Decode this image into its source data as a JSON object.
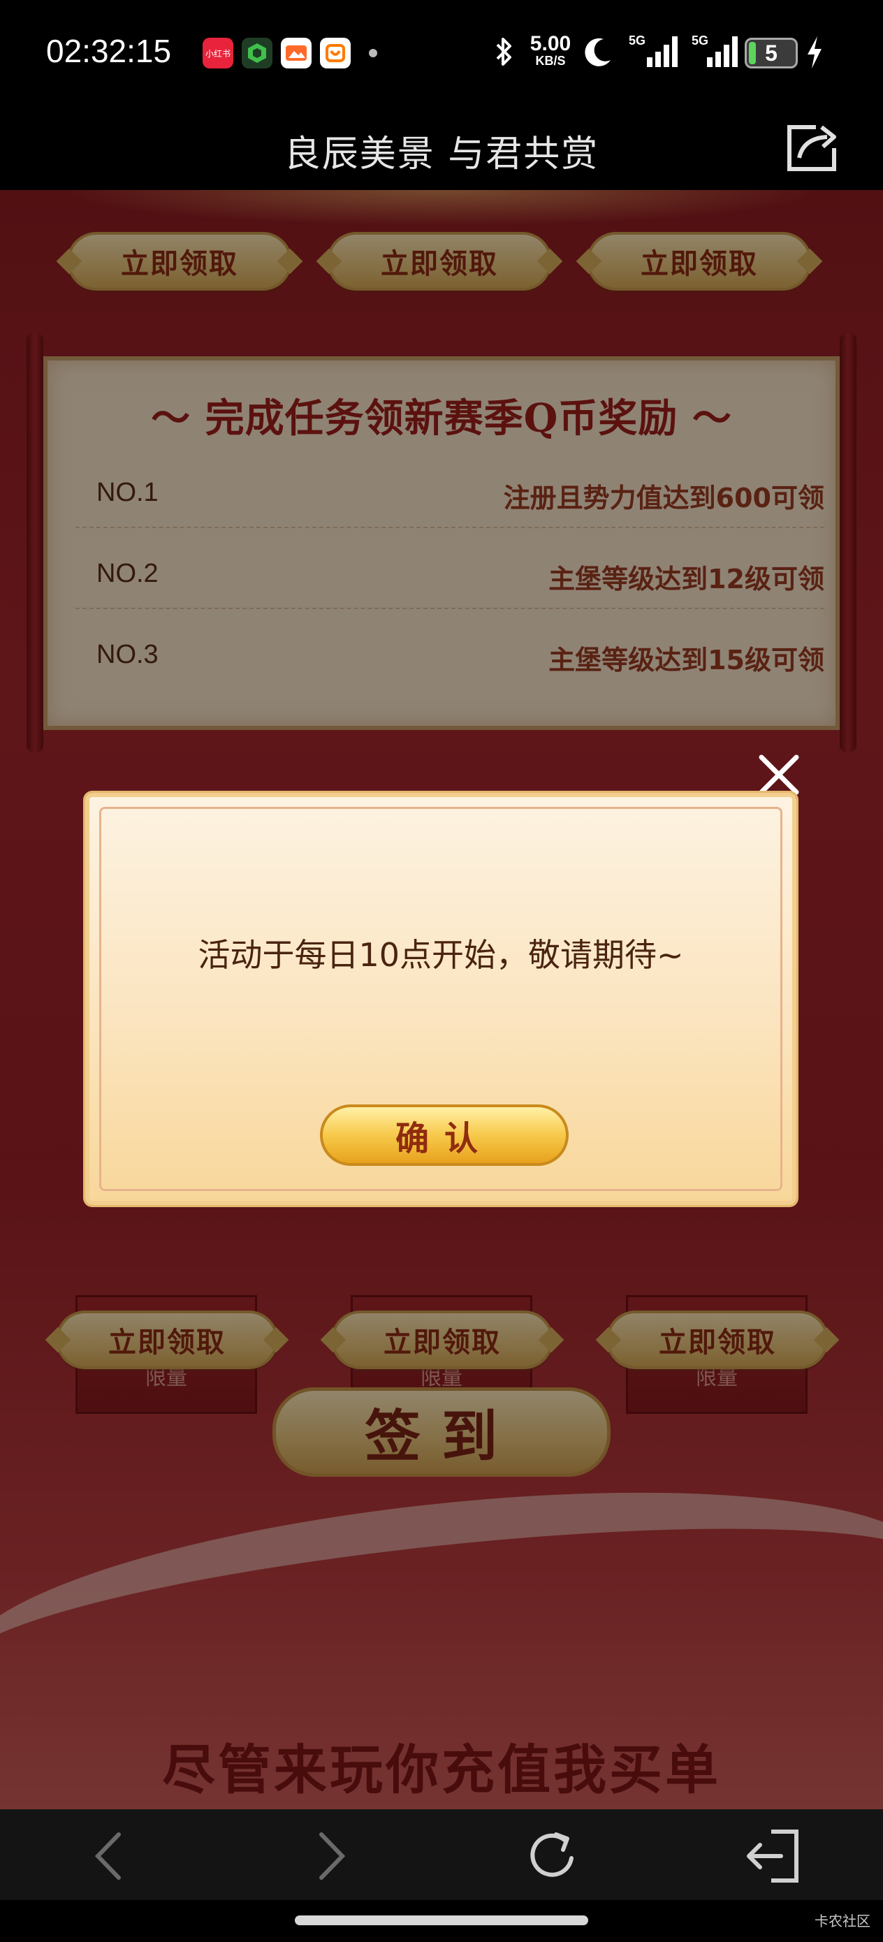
{
  "status_bar": {
    "time": "02:32:15",
    "app_icons": [
      "xiaohongshu-icon",
      "green-hexagon-app-icon",
      "orange-app-icon",
      "orange-basket-app-icon"
    ],
    "app_icon_text": [
      "小红书",
      "",
      "",
      ""
    ],
    "network_speed": "5.00",
    "network_speed_unit": "KB/S",
    "signal1": "5G",
    "signal2": "5G",
    "battery": "5"
  },
  "title_bar": {
    "title": "良辰美景 与君共赏"
  },
  "page": {
    "top_claim_buttons": [
      "立即领取",
      "立即领取",
      "立即领取"
    ],
    "task_panel": {
      "title": "～ 完成任务领新赛季Q币奖励 ～",
      "tasks": [
        {
          "no": "NO.1",
          "desc": "注册且势力值达到600可领"
        },
        {
          "no": "NO.2",
          "desc": "主堡等级达到12级可领"
        },
        {
          "no": "NO.3",
          "desc": "主堡等级达到15级可领"
        }
      ]
    },
    "reward_cards": [
      {
        "limit": "限量"
      },
      {
        "limit": "限量"
      },
      {
        "limit": "限量"
      }
    ],
    "bottom_claim_buttons": [
      "立即领取",
      "立即领取",
      "立即领取"
    ],
    "signin_label": "签到",
    "slogan": "尽管来玩你充值我买单"
  },
  "dialog": {
    "message": "活动于每日10点开始，敬请期待~",
    "confirm_label": "确认"
  },
  "watermark": "卡农社区",
  "colors": {
    "page_red": "#9a2228",
    "gold": "#e8c47e",
    "dialog_bg": "#fbe4bf",
    "confirm_gold": "#f7c94a"
  }
}
